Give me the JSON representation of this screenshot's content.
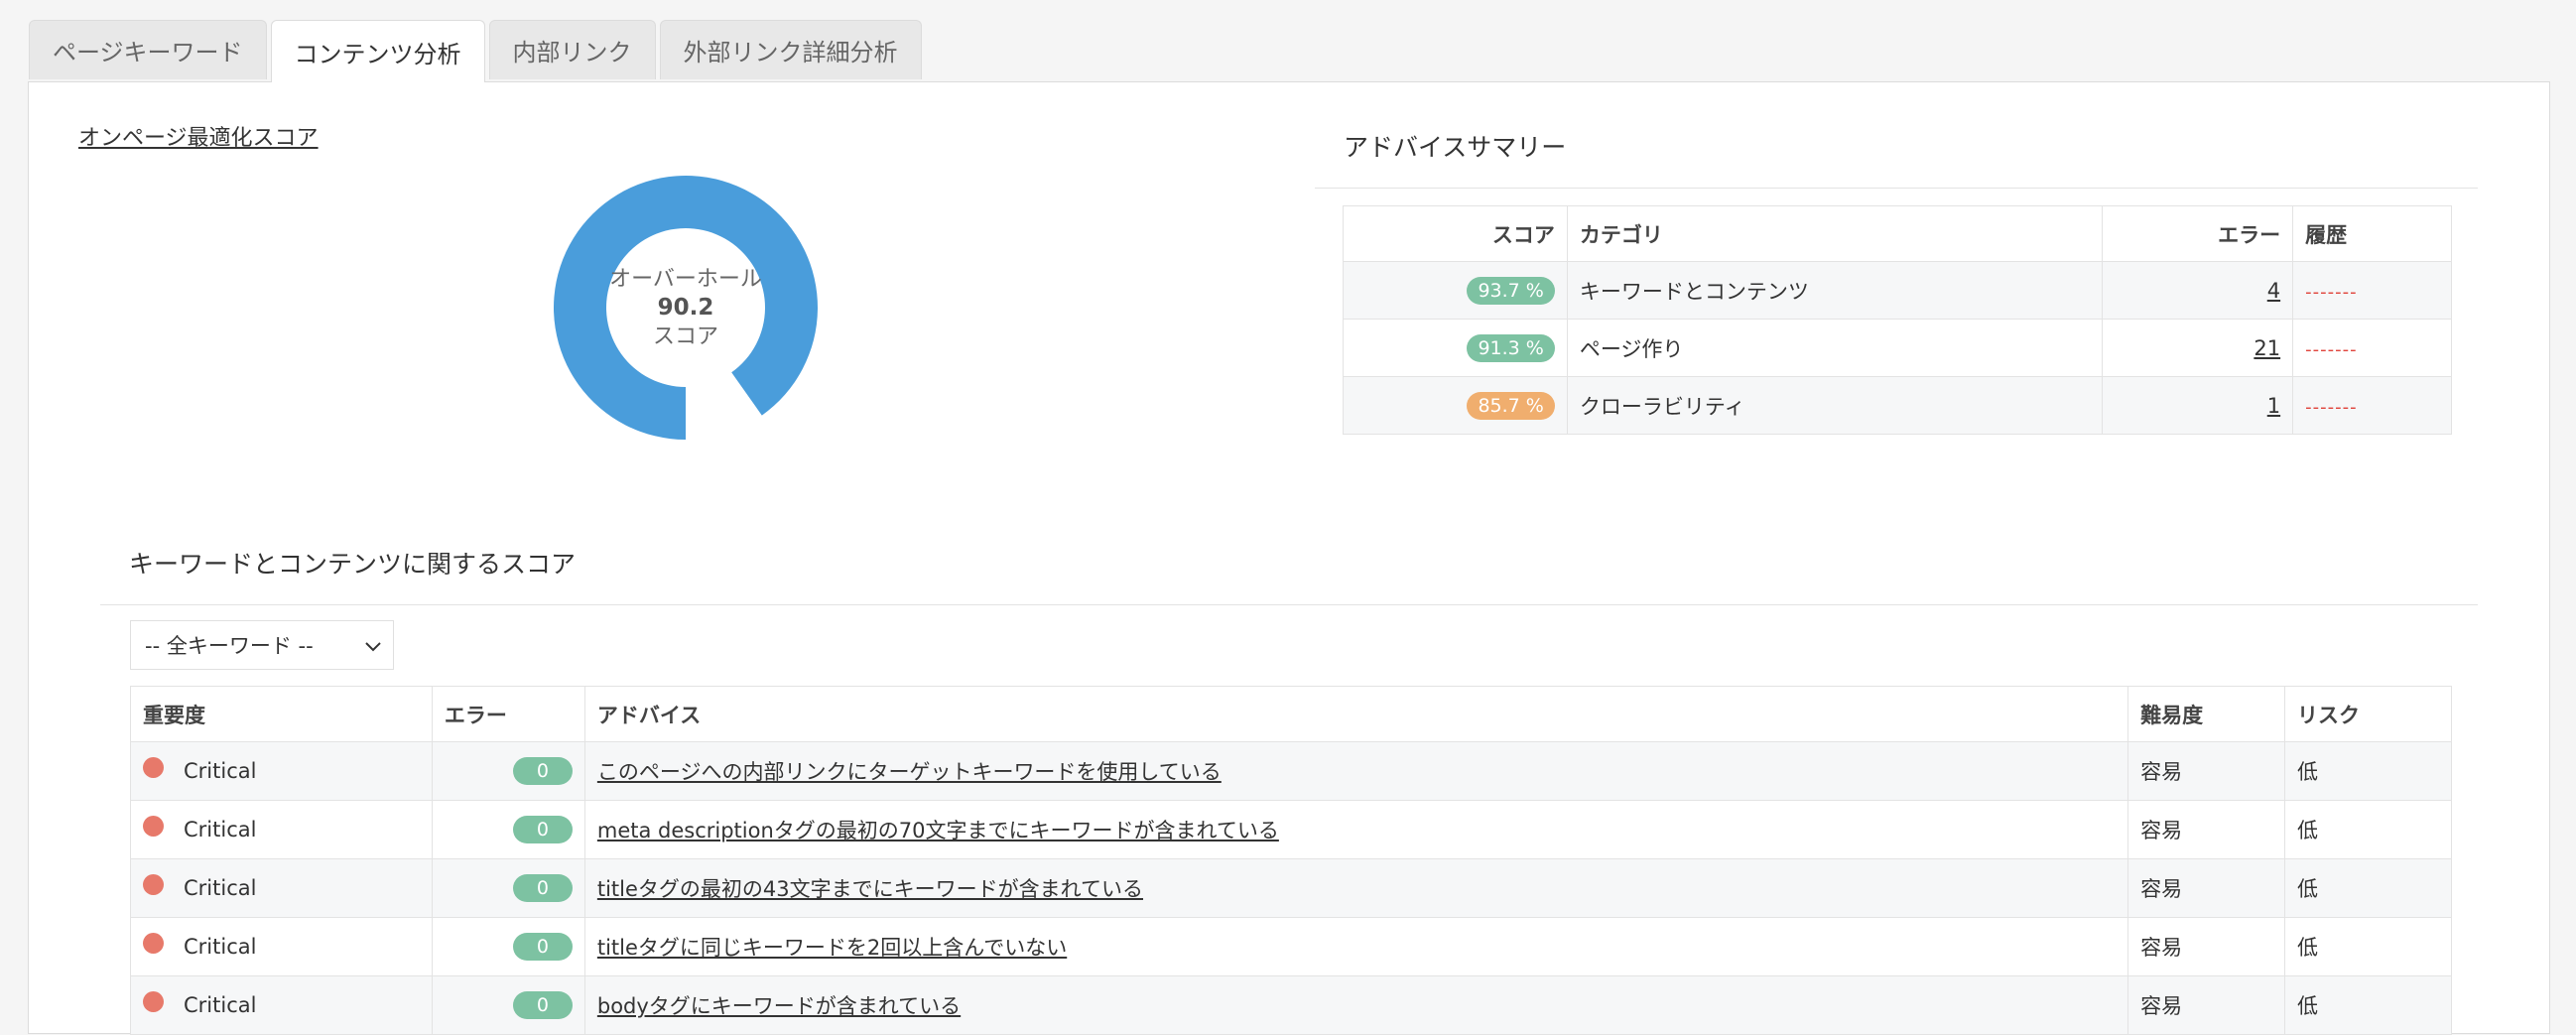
{
  "tabs": [
    "ページキーワード",
    "コンテンツ分析",
    "内部リンク",
    "外部リンク詳細分析"
  ],
  "active_tab": 1,
  "score_link": "オンページ最適化スコア",
  "donut": {
    "label_top": "オーバーホール",
    "value": "90.2",
    "label_bottom": "スコア",
    "percent": 90.2,
    "color": "#4a9ddb"
  },
  "summary": {
    "title": "アドバイスサマリー",
    "headers": [
      "スコア",
      "カテゴリ",
      "エラー",
      "履歴"
    ],
    "rows": [
      {
        "score": "93.7 %",
        "category": "キーワードとコンテンツ",
        "errors": "4",
        "history": "-------"
      },
      {
        "score": "91.3 %",
        "category": "ページ作り",
        "errors": "21",
        "history": "-------"
      },
      {
        "score": "85.7 %",
        "category": "クローラビリティ",
        "errors": "1",
        "history": "-------"
      }
    ]
  },
  "section": {
    "title": "キーワードとコンテンツに関するスコア",
    "select_value": "-- 全キーワード --",
    "headers": [
      "重要度",
      "エラー",
      "アドバイス",
      "難易度",
      "リスク"
    ],
    "rows": [
      {
        "severity": "Critical",
        "errors": "0",
        "advice": "このページへの内部リンクにターゲットキーワードを使用している",
        "difficulty": "容易",
        "risk": "低"
      },
      {
        "severity": "Critical",
        "errors": "0",
        "advice": "meta descriptionタグの最初の70文字までにキーワードが含まれている",
        "difficulty": "容易",
        "risk": "低"
      },
      {
        "severity": "Critical",
        "errors": "0",
        "advice": "titleタグの最初の43文字までにキーワードが含まれている",
        "difficulty": "容易",
        "risk": "低"
      },
      {
        "severity": "Critical",
        "errors": "0",
        "advice": "titleタグに同じキーワードを2回以上含んでいない",
        "difficulty": "容易",
        "risk": "低"
      },
      {
        "severity": "Critical",
        "errors": "0",
        "advice": "bodyタグにキーワードが含まれている",
        "difficulty": "容易",
        "risk": "低"
      }
    ]
  },
  "colors": {
    "green_badge": "#7dc2a2",
    "orange_badge": "#f0ae6e",
    "critical_dot": "#e7796a",
    "history_dash": "#e0453d"
  }
}
